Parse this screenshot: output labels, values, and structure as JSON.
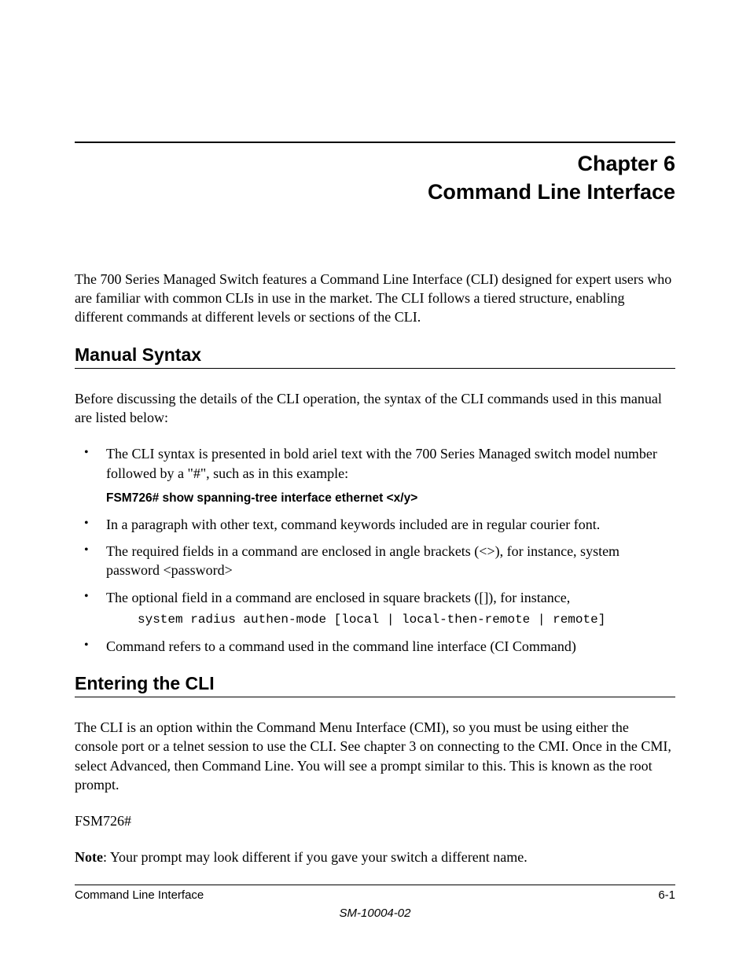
{
  "chapter": {
    "line1": "Chapter 6",
    "line2": "Command Line Interface"
  },
  "intro": "The 700 Series Managed Switch features a Command Line Interface (CLI) designed for expert users who are familiar with common CLIs in use in the market. The CLI follows a tiered structure, enabling different commands at different levels or sections of the CLI.",
  "section1": {
    "heading": "Manual Syntax",
    "lead": "Before discussing the details of the CLI operation, the syntax of the CLI commands used in this manual are listed below:",
    "bullets": {
      "b1": "The CLI syntax is presented in bold ariel text with the 700 Series Managed switch model number followed by a \"#\", such as in this example:",
      "b1_cli": "FSM726# show spanning-tree interface ethernet <x/y>",
      "b2": "In a paragraph with other text, command keywords included are in regular courier font.",
      "b3": "The required fields in a command are enclosed in angle brackets (<>), for instance, system password <password>",
      "b4": "The optional field in a command are enclosed in square brackets ([]), for instance,",
      "b4_mono": "system radius authen-mode [local | local-then-remote | remote]",
      "b5": "Command refers to a command used in the command line interface (CI Command)"
    }
  },
  "section2": {
    "heading": "Entering the CLI",
    "para1": "The CLI is an option within the Command Menu Interface (CMI), so you must be using either the console port or a telnet session to use the CLI.  See chapter 3 on connecting to the CMI.  Once in the CMI, select Advanced, then Command Line.  You will see a prompt similar to this. This is known as the root prompt.",
    "prompt": "FSM726#",
    "note_label": "Note",
    "note_text": ": Your prompt may look different if you gave your switch a different name."
  },
  "footer": {
    "left": "Command Line Interface",
    "right": "6-1",
    "center": "SM-10004-02"
  }
}
